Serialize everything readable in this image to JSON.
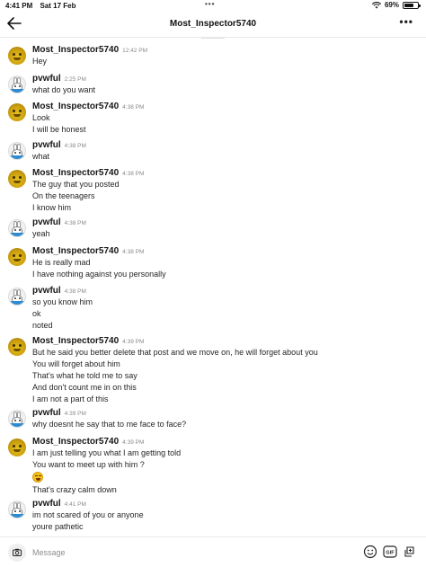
{
  "status_bar": {
    "time": "4:41 PM",
    "date": "Sat 17 Feb",
    "battery_percent": "69%",
    "battery_level": 0.69
  },
  "header": {
    "title": "Most_Inspector5740",
    "back_icon": "arrow-left-icon",
    "more_icon": "more-horizontal-icon"
  },
  "messages": [
    {
      "sender": "Most_Inspector5740",
      "avatar": "yellow-avatar",
      "time": "12:42 PM",
      "lines": [
        "Hey"
      ]
    },
    {
      "sender": "pvwful",
      "avatar": "bunny-avatar",
      "time": "2:25 PM",
      "lines": [
        "what do you want"
      ]
    },
    {
      "sender": "Most_Inspector5740",
      "avatar": "yellow-avatar",
      "time": "4:38 PM",
      "lines": [
        "Look",
        "I will be honest"
      ]
    },
    {
      "sender": "pvwful",
      "avatar": "bunny-avatar",
      "time": "4:38 PM",
      "lines": [
        "what"
      ]
    },
    {
      "sender": "Most_Inspector5740",
      "avatar": "yellow-avatar",
      "time": "4:38 PM",
      "lines": [
        "The guy that you posted",
        "On the teenagers",
        "I know him"
      ]
    },
    {
      "sender": "pvwful",
      "avatar": "bunny-avatar",
      "time": "4:38 PM",
      "lines": [
        "yeah"
      ]
    },
    {
      "sender": "Most_Inspector5740",
      "avatar": "yellow-avatar",
      "time": "4:38 PM",
      "lines": [
        "He is really mad",
        "I have nothing against you personally"
      ]
    },
    {
      "sender": "pvwful",
      "avatar": "bunny-avatar",
      "time": "4:38 PM",
      "lines": [
        "so you know him",
        "ok",
        "noted"
      ]
    },
    {
      "sender": "Most_Inspector5740",
      "avatar": "yellow-avatar",
      "time": "4:39 PM",
      "lines": [
        "But he said you better delete that post and we move on, he will forget about you",
        "You will forget about him",
        "That's what he told me to say",
        "And don't count me in on this",
        "I am not a part of this"
      ]
    },
    {
      "sender": "pvwful",
      "avatar": "bunny-avatar",
      "time": "4:39 PM",
      "lines": [
        "why doesnt he say that to me face to face?"
      ]
    },
    {
      "sender": "Most_Inspector5740",
      "avatar": "yellow-avatar",
      "time": "4:39 PM",
      "lines": [
        "I am just telling you what I am getting told",
        "You want to meet up with him ?",
        "[laughing-emoji]",
        "That's crazy calm down"
      ]
    },
    {
      "sender": "pvwful",
      "avatar": "bunny-avatar",
      "time": "4:41 PM",
      "lines": [
        "im not scared of you or anyone",
        "youre pathetic"
      ]
    }
  ],
  "composer": {
    "placeholder": "Message",
    "camera_icon": "camera-icon",
    "emoji_icon": "smiley-icon",
    "gif_icon": "gif-icon",
    "add_icon": "add-icon"
  }
}
